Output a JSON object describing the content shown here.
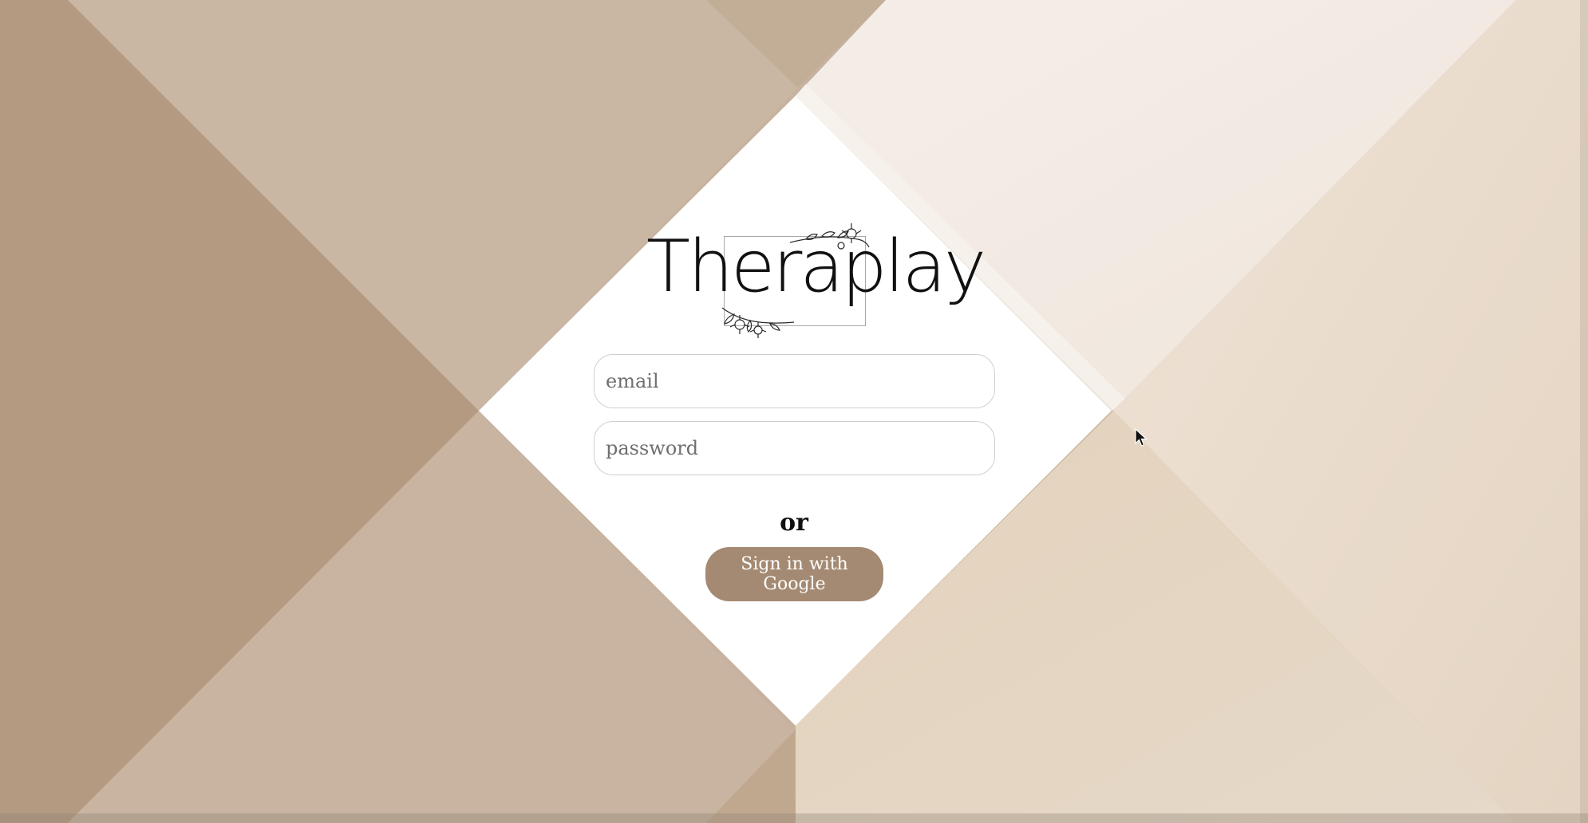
{
  "app": {
    "logo_text": "Theraplay"
  },
  "form": {
    "email_placeholder": "email",
    "password_placeholder": "password",
    "separator": "or",
    "google_button_label": "Sign in with Google"
  },
  "colors": {
    "button": "#a48a72",
    "panel": "#ffffff",
    "tan_dark": "#b29a81",
    "tan_mid": "#c8b5a2",
    "tan_light": "#e6d8c6",
    "cream": "#f3ebe4"
  },
  "icons": {
    "cursor": "mouse-pointer-icon",
    "logo_decoration": "floral-branch-icon"
  }
}
